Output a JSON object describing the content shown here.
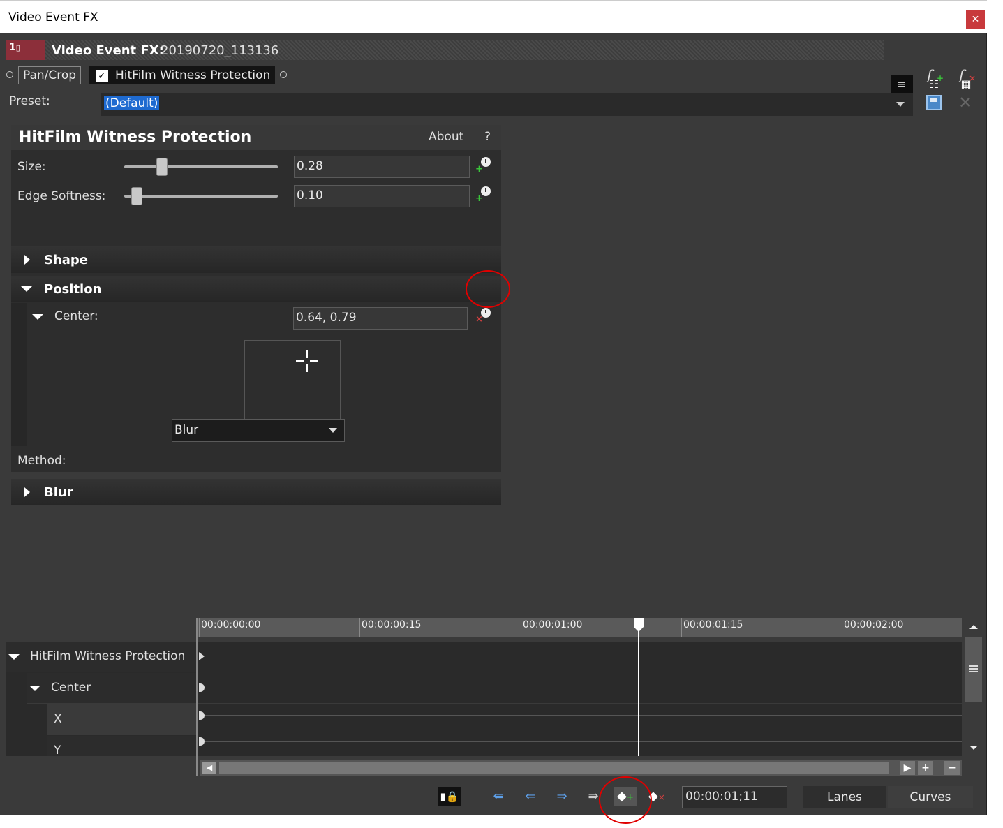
{
  "window": {
    "title": "Video Event FX",
    "close_glyph": "✕"
  },
  "header": {
    "track_number": "1",
    "label": "Video Event FX:",
    "filename": "20190720_113136"
  },
  "view_buttons": [
    "view-single",
    "view-double",
    "view-grid"
  ],
  "chain": {
    "plugin1": "Pan/Crop",
    "plugin2": "HitFilm Witness Protection",
    "plugin2_checked": true
  },
  "preset": {
    "label": "Preset:",
    "value": "(Default)"
  },
  "panel": {
    "title": "HitFilm Witness Protection",
    "about": "About",
    "help": "?",
    "size_label": "Size:",
    "size_value": "0.28",
    "size_level": 0.28,
    "edge_label": "Edge Softness:",
    "edge_value": "0.10",
    "edge_level": 0.1,
    "shape_label": "Shape",
    "position_label": "Position",
    "center_label": "Center:",
    "center_value": "0.64, 0.79",
    "method_label": "Method:",
    "method_value": "Blur",
    "blur_label": "Blur"
  },
  "timeline": {
    "ticks": [
      "00:00:00:00",
      "00:00:00:15",
      "00:00:01:00",
      "00:00:01:15",
      "00:00:02:00"
    ],
    "rows": {
      "effect": "HitFilm Witness Protection",
      "center": "Center",
      "x": "X",
      "y": "Y"
    },
    "current_time": "00:00:01;11"
  },
  "toolbar": {
    "lanes": "Lanes",
    "curves": "Curves"
  },
  "colors": {
    "accent": "#1e6ad0",
    "track_badge": "#8c2f3a",
    "annotation": "#e00000"
  }
}
